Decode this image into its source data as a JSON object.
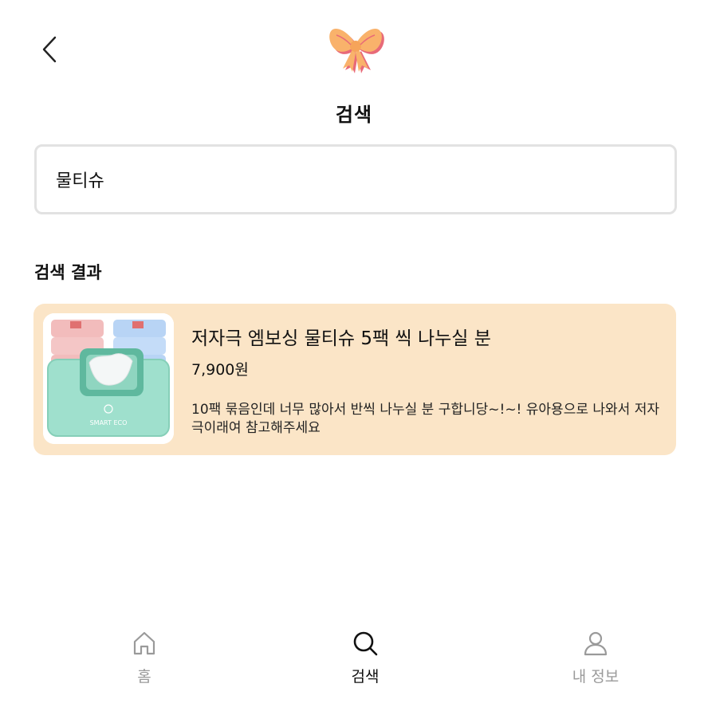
{
  "header": {
    "back_icon": "chevron-left-icon",
    "logo_icon": "ribbon-bow-icon",
    "title": "검색"
  },
  "search": {
    "value": "물티슈",
    "placeholder": ""
  },
  "results": {
    "section_title": "검색 결과",
    "items": [
      {
        "title": "저자극 엠보싱 물티슈 5팩 씩 나누실 분",
        "price": "7,900원",
        "description": "10팩 묶음인데 너무 많아서 반씩 나누실 분 구합니당~!~! 유아용으로 나와서 저자극이래여 참고해주세요",
        "thumb_brand": "SMART ECO"
      }
    ]
  },
  "bottom_nav": {
    "items": [
      {
        "label": "홈",
        "icon": "home-icon",
        "active": false
      },
      {
        "label": "검색",
        "icon": "search-icon",
        "active": true
      },
      {
        "label": "내 정보",
        "icon": "user-icon",
        "active": false
      }
    ]
  },
  "colors": {
    "card_background": "#fbe5c7",
    "border": "#e2e2e2",
    "inactive_nav": "#9a9a9a",
    "active_nav": "#111111",
    "bow_main": "#f9b26b",
    "bow_shadow": "#e86a78"
  }
}
